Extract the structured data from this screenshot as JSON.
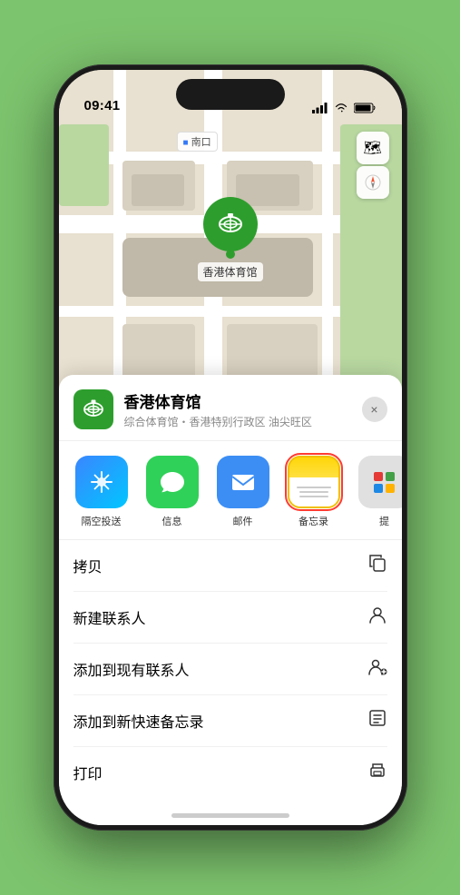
{
  "status_bar": {
    "time": "09:41",
    "location_icon": "▶",
    "signal": "●●●●",
    "wifi": "wifi",
    "battery": "battery"
  },
  "map": {
    "label": "南口",
    "location_name": "香港体育馆"
  },
  "map_controls": [
    {
      "icon": "🗺",
      "name": "map-type-button"
    },
    {
      "icon": "⬆",
      "name": "compass-button"
    }
  ],
  "venue": {
    "name": "香港体育馆",
    "subtitle": "综合体育馆・香港特别行政区 油尖旺区"
  },
  "close_label": "×",
  "share_apps": [
    {
      "id": "airdrop",
      "label": "隔空投送",
      "type": "airdrop"
    },
    {
      "id": "messages",
      "label": "信息",
      "type": "messages"
    },
    {
      "id": "mail",
      "label": "邮件",
      "type": "mail"
    },
    {
      "id": "notes",
      "label": "备忘录",
      "type": "notes",
      "selected": true
    },
    {
      "id": "more",
      "label": "提",
      "type": "more"
    }
  ],
  "actions": [
    {
      "id": "copy",
      "label": "拷贝",
      "icon": "copy"
    },
    {
      "id": "new-contact",
      "label": "新建联系人",
      "icon": "person"
    },
    {
      "id": "add-existing",
      "label": "添加到现有联系人",
      "icon": "person-add"
    },
    {
      "id": "add-quick",
      "label": "添加到新快速备忘录",
      "icon": "memo"
    },
    {
      "id": "print",
      "label": "打印",
      "icon": "print"
    }
  ]
}
